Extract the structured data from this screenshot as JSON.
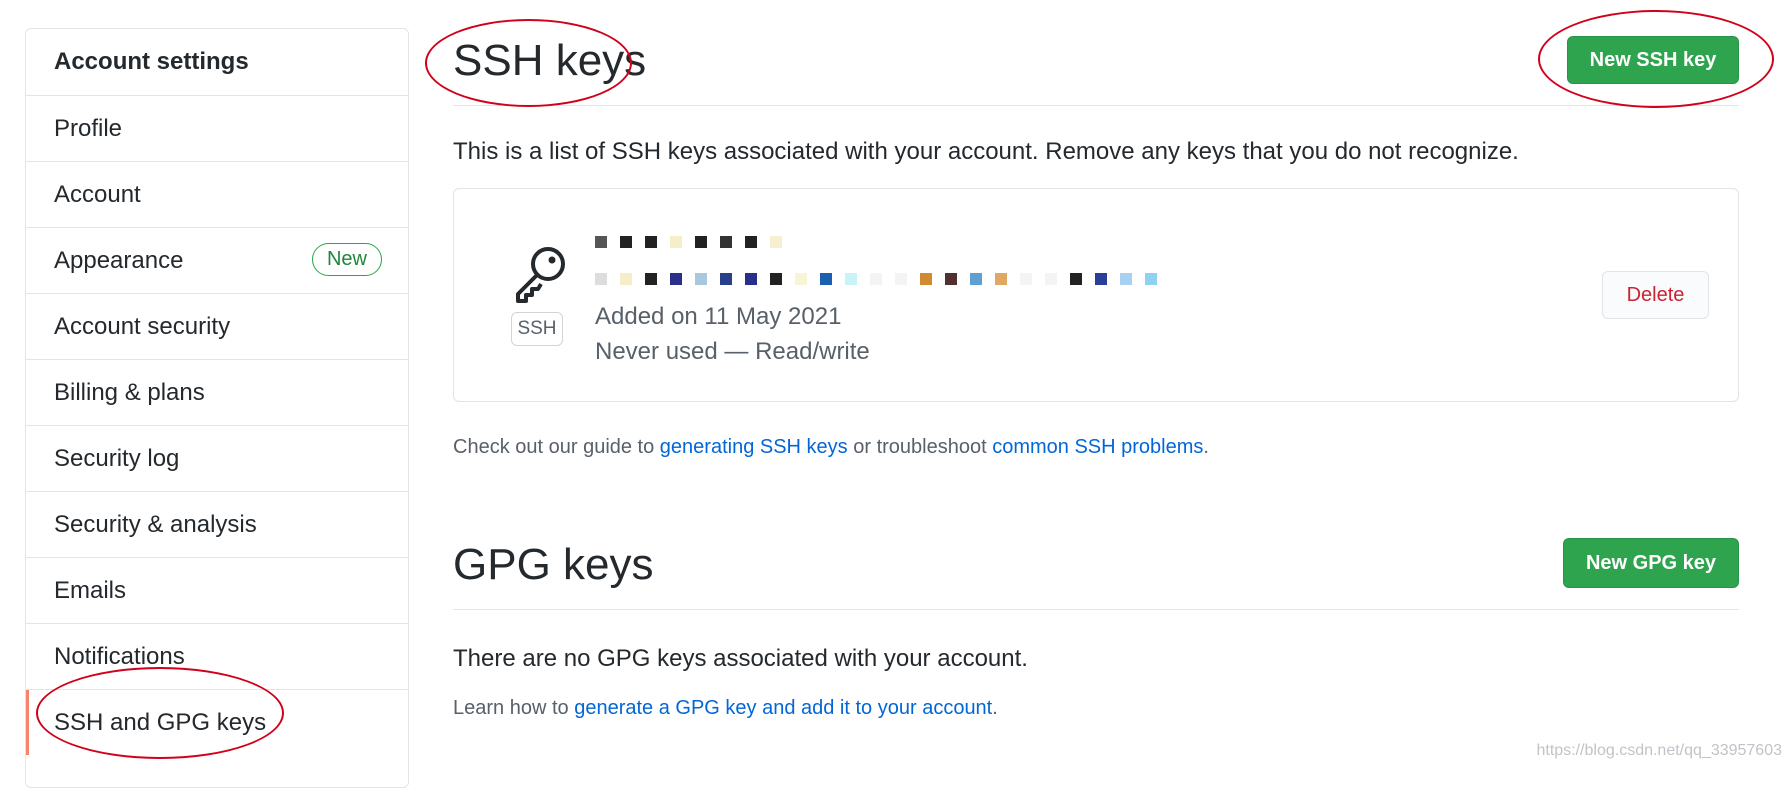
{
  "sidebar": {
    "heading": "Account settings",
    "items": [
      {
        "label": "Profile"
      },
      {
        "label": "Account"
      },
      {
        "label": "Appearance",
        "badge": "New"
      },
      {
        "label": "Account security"
      },
      {
        "label": "Billing & plans"
      },
      {
        "label": "Security log"
      },
      {
        "label": "Security & analysis"
      },
      {
        "label": "Emails"
      },
      {
        "label": "Notifications"
      },
      {
        "label": "SSH and GPG keys",
        "selected": true
      }
    ]
  },
  "ssh": {
    "title": "SSH keys",
    "new_button": "New SSH key",
    "description": "This is a list of SSH keys associated with your account. Remove any keys that you do not recognize.",
    "key": {
      "type_label": "SSH",
      "added": "Added on 11 May 2021",
      "usage": "Never used — Read/write",
      "delete_label": "Delete"
    },
    "guide": {
      "prefix": "Check out our guide to ",
      "link1": "generating SSH keys",
      "middle": " or troubleshoot ",
      "link2": "common SSH problems",
      "suffix": "."
    }
  },
  "gpg": {
    "title": "GPG keys",
    "new_button": "New GPG key",
    "empty_message": "There are no GPG keys associated with your account.",
    "learn": {
      "prefix": "Learn how to ",
      "link": "generate a GPG key and add it to your account",
      "suffix": "."
    }
  },
  "watermark": "https://blog.csdn.net/qq_33957603",
  "colors": {
    "accent_selected": "#f9826c",
    "primary_button": "#2ea44f",
    "link": "#0366d6",
    "danger": "#cb2431",
    "annotation": "#d0021b"
  }
}
